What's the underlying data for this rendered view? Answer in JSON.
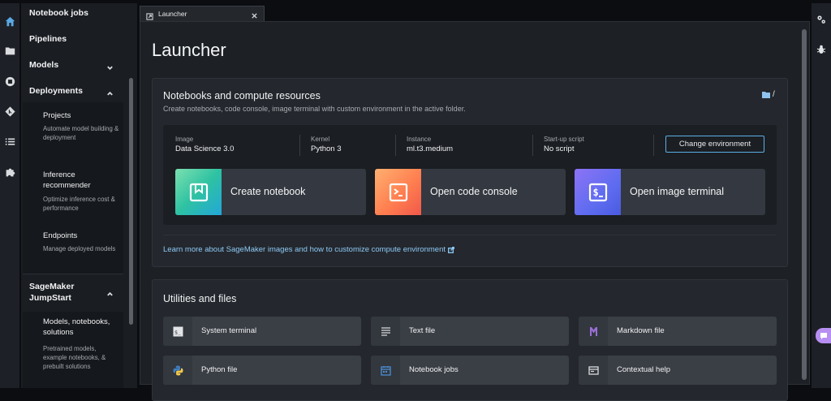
{
  "activity_bar": {
    "icons": [
      "home-icon",
      "folder-icon",
      "stop-circle-icon",
      "git-icon",
      "list-icon",
      "puzzle-icon"
    ],
    "accent": "#5aa9e6"
  },
  "sidebar": {
    "items": [
      {
        "label": "Notebook jobs"
      },
      {
        "label": "Pipelines"
      },
      {
        "label": "Models",
        "expanded": false
      },
      {
        "label": "Deployments",
        "expanded": true
      }
    ],
    "deployments_children": [
      {
        "title": "Projects",
        "desc": "Automate model building & deployment"
      },
      {
        "title": "Inference recommender",
        "desc": "Optimize inference cost & performance"
      },
      {
        "title": "Endpoints",
        "desc": "Manage deployed models"
      }
    ],
    "jumpstart": {
      "label": "SageMaker JumpStart",
      "expanded": true,
      "children": [
        {
          "title": "Models, notebooks, solutions",
          "desc": "Pretrained models, example notebooks, & prebuilt solutions"
        }
      ]
    }
  },
  "tab": {
    "label": "Launcher"
  },
  "launcher": {
    "title": "Launcher",
    "notebooks": {
      "title": "Notebooks and compute resources",
      "subtitle": "Create notebooks, code console, image terminal with custom environment in the active folder.",
      "folder_path": "/",
      "env": [
        {
          "label": "Image",
          "value": "Data Science 3.0"
        },
        {
          "label": "Kernel",
          "value": "Python 3"
        },
        {
          "label": "Instance",
          "value": "ml.t3.medium"
        },
        {
          "label": "Start-up script",
          "value": "No script"
        }
      ],
      "change_env_label": "Change environment",
      "tiles": [
        {
          "label": "Create notebook",
          "icon": "notebook-icon"
        },
        {
          "label": "Open code console",
          "icon": "code-console-icon"
        },
        {
          "label": "Open image terminal",
          "icon": "image-terminal-icon"
        }
      ],
      "learn_more": "Learn more about SageMaker images and how to customize compute environment"
    },
    "utilities": {
      "title": "Utilities and files",
      "tiles": [
        {
          "label": "System terminal",
          "icon": "terminal-icon"
        },
        {
          "label": "Text file",
          "icon": "text-file-icon"
        },
        {
          "label": "Markdown file",
          "icon": "markdown-icon"
        },
        {
          "label": "Python file",
          "icon": "python-icon"
        },
        {
          "label": "Notebook jobs",
          "icon": "calendar-icon"
        },
        {
          "label": "Contextual help",
          "icon": "help-panel-icon"
        }
      ]
    }
  },
  "right_bar": {
    "icons": [
      "gears-icon",
      "bug-icon"
    ],
    "chat_icon": "chat-icon",
    "chat_color": "#b78ef2"
  }
}
